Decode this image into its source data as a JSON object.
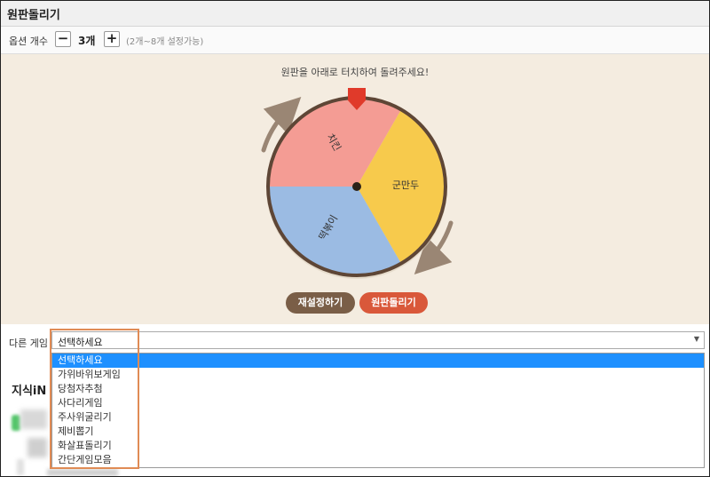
{
  "window": {
    "title": "원판돌리기"
  },
  "options": {
    "label": "옵션 개수",
    "minus_icon": "minus-icon",
    "plus_icon": "plus-icon",
    "count": "3개",
    "hint": "(2개~8개 설정가능)"
  },
  "wheel": {
    "instruction": "원판을 아래로 터치하여 돌려주세요!",
    "segments": [
      {
        "label": "치킨",
        "color": "#f49c94"
      },
      {
        "label": "군만두",
        "color": "#f7ca4c"
      },
      {
        "label": "떡볶이",
        "color": "#9bbbe3"
      }
    ],
    "pointer_color": "#e03a2a",
    "rim_color": "#5e4636",
    "reset_label": "재설정하기",
    "spin_label": "원판돌리기"
  },
  "game": {
    "label": "다른 게임",
    "selected": "선택하세요",
    "options": [
      "선택하세요",
      "가위바위보게임",
      "당첨자추첨",
      "사다리게임",
      "주사위굴리기",
      "제비뽑기",
      "화살표돌리기",
      "간단게임모음"
    ]
  },
  "below": {
    "heading": "지식iN"
  },
  "colors": {
    "accent": "#1e90ff",
    "highlight": "#e08b55",
    "spin_button": "#d9583a",
    "reset_button": "#7a5e47"
  }
}
